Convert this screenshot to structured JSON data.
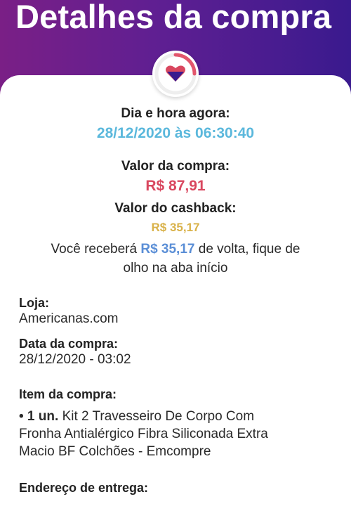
{
  "header": {
    "title": "Detalhes da compra"
  },
  "summary": {
    "datetime_label": "Dia e hora agora:",
    "datetime_value": "28/12/2020 às 06:30:40",
    "purchase_label": "Valor da compra:",
    "purchase_value": "R$ 87,91",
    "cashback_label": "Valor do cashback:",
    "cashback_value": "R$ 35,17",
    "message_prefix": "Você receberá",
    "message_amount": "R$ 35,17",
    "message_suffix": "de volta, fique de",
    "message_line2": "olho na aba início"
  },
  "details": {
    "store_label": "Loja:",
    "store_value": "Americanas.com",
    "date_label": "Data da compra:",
    "date_value": "28/12/2020 - 03:02",
    "item_label": "Item da compra:",
    "item_bullet": "• 1 un.",
    "item_line1": "Kit 2 Travesseiro De Corpo Com",
    "item_line2": "Fronha Antialérgico Fibra Siliconada Extra",
    "item_line3": "Macio BF Colchões - Emcompre",
    "address_label": "Endereço de entrega:"
  },
  "colors": {
    "header_start": "#7a1f86",
    "header_end": "#3a1a8e",
    "date_blue": "#5bb8dc",
    "price_red": "#d9475f",
    "cashback_gold": "#d9b24a",
    "amount_blue": "#5a8ed6"
  },
  "icons": {
    "logo": "heart-logo-icon"
  }
}
